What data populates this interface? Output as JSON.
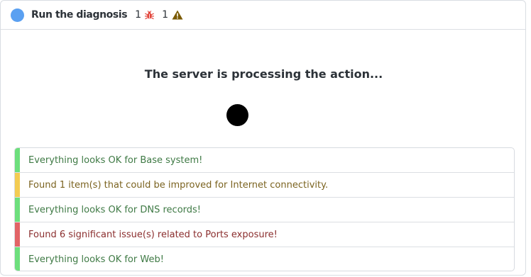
{
  "header": {
    "title": "Run the diagnosis",
    "error_count": "1",
    "warning_count": "1",
    "icons": {
      "status": "status-dot",
      "errors": "bug-icon",
      "warnings": "warning-triangle-icon"
    },
    "colors": {
      "status": "#5aa0f1",
      "error": "#e2453b",
      "warning": "#7a5a00"
    }
  },
  "main": {
    "processing_text": "The server is processing the action..."
  },
  "results": [
    {
      "status": "success",
      "text": "Everything looks OK for Base system!"
    },
    {
      "status": "warning",
      "text": "Found 1 item(s) that could be improved for Internet connectivity."
    },
    {
      "status": "success",
      "text": "Everything looks OK for DNS records!"
    },
    {
      "status": "danger",
      "text": "Found 6 significant issue(s) related to Ports exposure!"
    },
    {
      "status": "success",
      "text": "Everything looks OK for Web!"
    }
  ],
  "colors": {
    "success": "#6ddf7c",
    "warning": "#f3cc52",
    "danger": "#e26466"
  }
}
